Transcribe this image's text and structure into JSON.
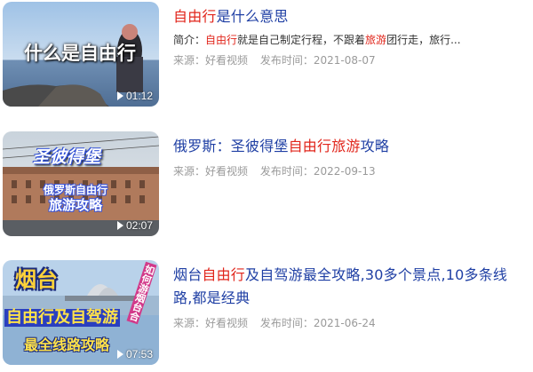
{
  "results": [
    {
      "title_parts": [
        {
          "text": "自由行",
          "highlight": true
        },
        {
          "text": "是什么意思",
          "highlight": false
        }
      ],
      "summary_parts": [
        {
          "text": "简介：",
          "highlight": false
        },
        {
          "text": "自由行",
          "highlight": true
        },
        {
          "text": "就是自己制定行程，不跟着",
          "highlight": false
        },
        {
          "text": "旅游",
          "highlight": true
        },
        {
          "text": "团行走，旅行...",
          "highlight": false
        }
      ],
      "source": "来源：好看视频",
      "publish_time": "发布时间：2021-08-07",
      "duration": "01:12",
      "thumb_text": [
        "什么是自由行"
      ]
    },
    {
      "title_parts": [
        {
          "text": "俄罗斯：圣彼得堡",
          "highlight": false
        },
        {
          "text": "自由行",
          "highlight": true
        },
        {
          "text": "旅游",
          "highlight": true
        },
        {
          "text": "攻略",
          "highlight": false
        }
      ],
      "summary_parts": [],
      "source": "来源：好看视频",
      "publish_time": "发布时间：2022-09-13",
      "duration": "02:07",
      "thumb_text": [
        "圣彼得堡",
        "俄罗斯自由行",
        "旅游攻略"
      ]
    },
    {
      "title_parts": [
        {
          "text": "烟台",
          "highlight": false
        },
        {
          "text": "自由行",
          "highlight": true
        },
        {
          "text": "及自驾游最全攻略,30多个景点,10多条线路,都是经典",
          "highlight": false
        }
      ],
      "summary_parts": [],
      "source": "来源：好看视频",
      "publish_time": "发布时间：2021-06-24",
      "duration": "07:53",
      "thumb_text": [
        "烟台",
        "自由行及自驾游",
        "最全线路攻略",
        "如何游烟台合"
      ]
    }
  ],
  "colors": {
    "title": "#1f3fa4",
    "highlight": "#e1251b",
    "meta": "#9a9a9a"
  }
}
